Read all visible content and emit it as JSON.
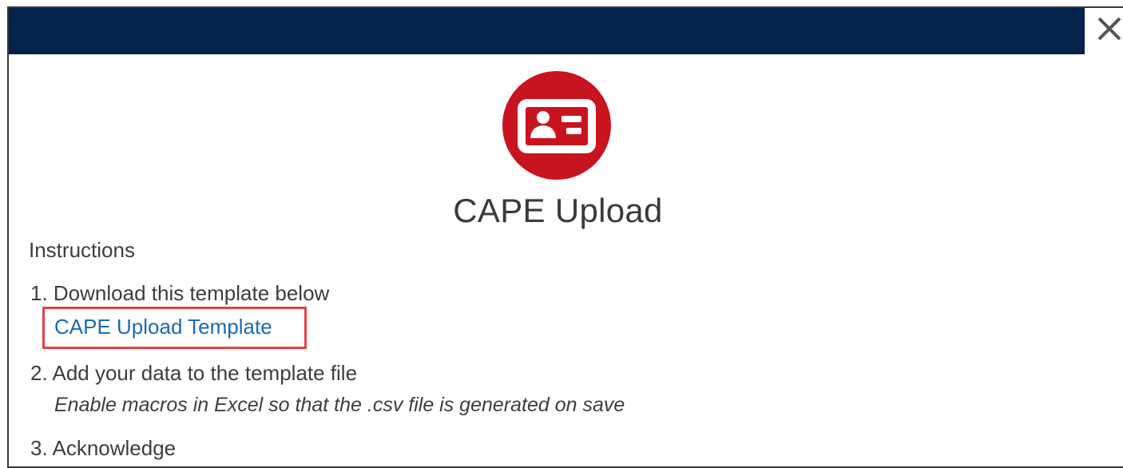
{
  "modal": {
    "title": "CAPE Upload",
    "icon": "contact-card-icon",
    "close_icon": "close-icon",
    "header_color": "#04234a",
    "icon_color": "#c8141e",
    "link_color": "#1b6bb5",
    "highlight_color": "#e8413f"
  },
  "instructions": {
    "label": "Instructions",
    "steps": [
      {
        "text": "1. Download this template below",
        "link": "CAPE Upload Template"
      },
      {
        "text": "2. Add your data to the template file",
        "note": "Enable macros in Excel so that the .csv file is generated on save"
      },
      {
        "text": "3. Acknowledge"
      }
    ]
  }
}
